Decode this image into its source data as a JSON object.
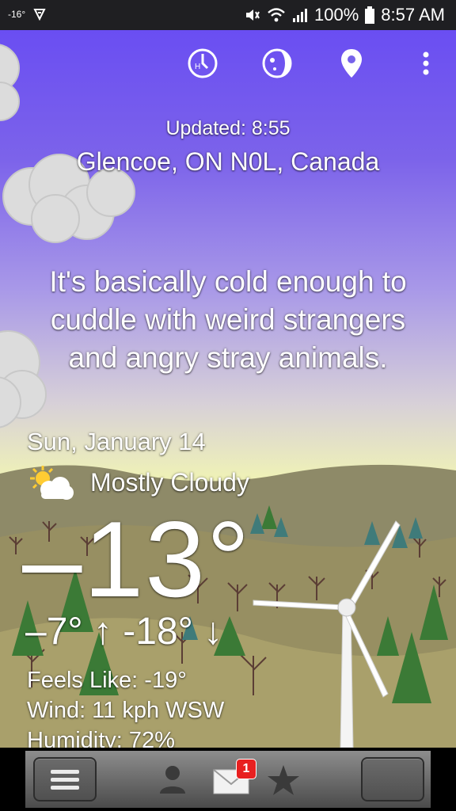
{
  "status_bar": {
    "temperature": "-16°",
    "battery": "100%",
    "time": "8:57 AM"
  },
  "toolbar": {
    "icons": [
      "history-clock-icon",
      "moon-phase-icon",
      "location-pin-icon",
      "more-vert-icon"
    ]
  },
  "header": {
    "updated": "Updated: 8:55",
    "location": "Glencoe, ON N0L, Canada"
  },
  "quote": "It's basically cold enough to cuddle with weird strangers and angry stray animals.",
  "forecast": {
    "date": "Sun, January 14",
    "condition": "Mostly Cloudy",
    "temperature": "–13°",
    "high_low": "–7° ↑ -18° ↓",
    "feels_like": "Feels Like: -19°",
    "wind": "Wind: 11 kph WSW",
    "humidity": "Humidity: 72%"
  },
  "bottom_nav": {
    "mail_badge": "1"
  }
}
